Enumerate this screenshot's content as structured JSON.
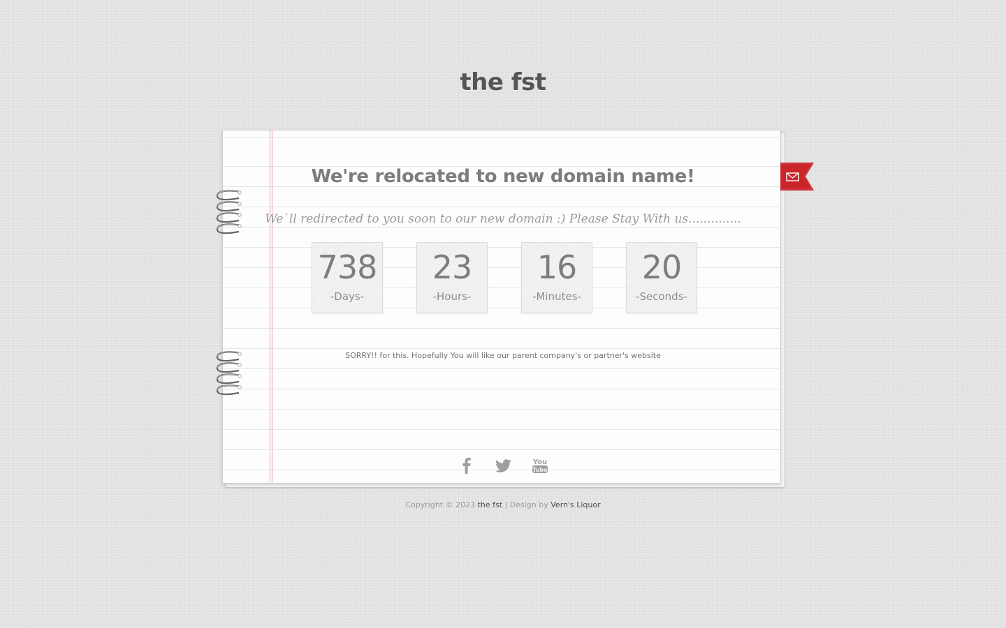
{
  "site": {
    "title": "the fst"
  },
  "notice": {
    "headline": "We're relocated to new domain name!",
    "subtext": "We`ll redirected to you soon to our new domain :) Please Stay With us..............",
    "apology": "SORRY!! for this. Hopefully You will like our parent company's or partner's website"
  },
  "countdown": [
    {
      "value": "738",
      "label": "-Days-"
    },
    {
      "value": "23",
      "label": "-Hours-"
    },
    {
      "value": "16",
      "label": "-Minutes-"
    },
    {
      "value": "20",
      "label": "-Seconds-"
    }
  ],
  "social": [
    {
      "name": "facebook",
      "icon": "facebook-icon"
    },
    {
      "name": "twitter",
      "icon": "twitter-icon"
    },
    {
      "name": "youtube",
      "icon": "youtube-icon"
    }
  ],
  "contact_ribbon": {
    "icon": "envelope-icon",
    "color": "#c9252b"
  },
  "footer": {
    "copyright": "Copyright © 2023",
    "site_link": "the fst",
    "separator": "| Design by",
    "designer_link": "Vern's Liquor"
  },
  "colors": {
    "background": "#e2e2e2",
    "paper": "#fdfdfd",
    "margin_line": "#e8a9a9",
    "text": "#7c7c7c"
  }
}
